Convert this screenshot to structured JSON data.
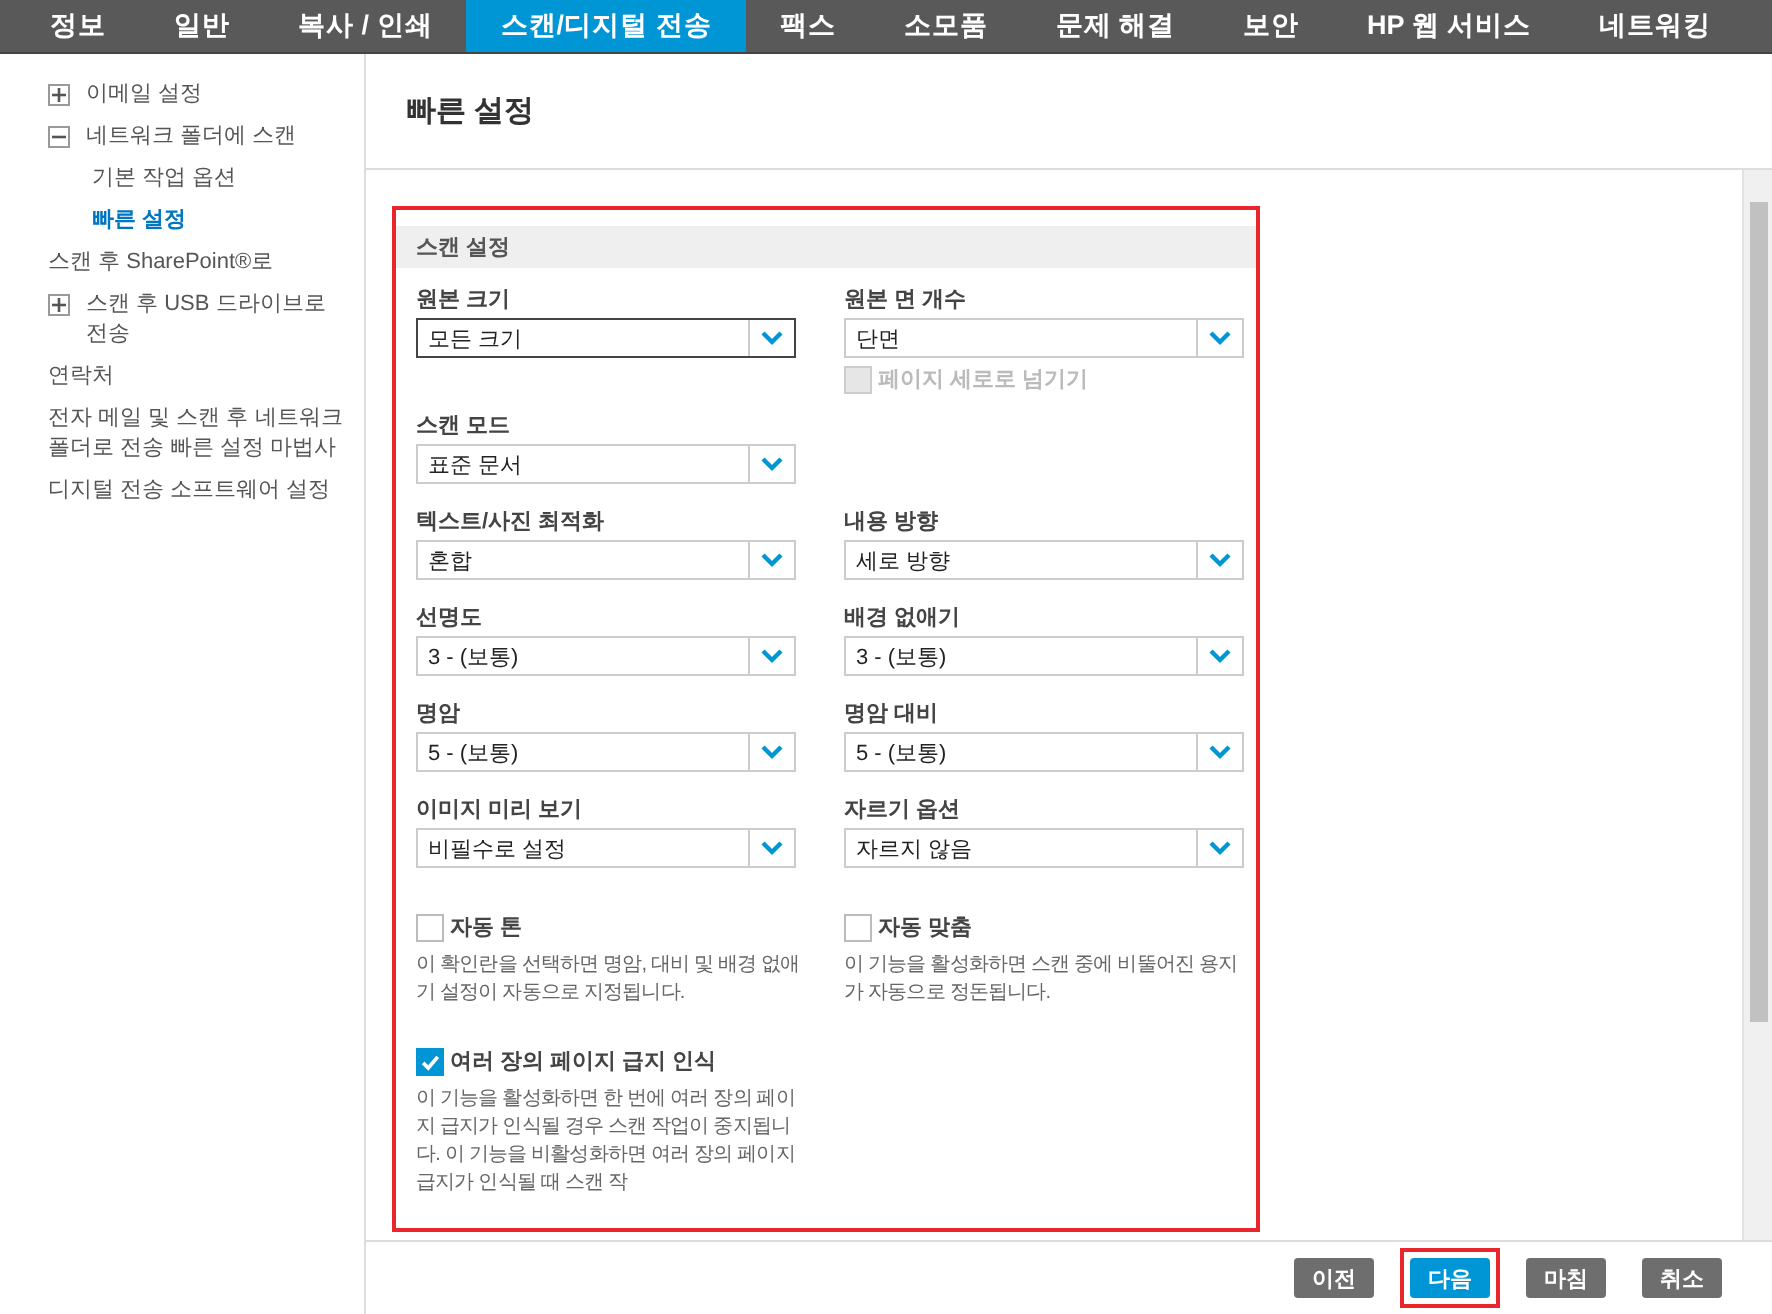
{
  "nav_tabs": [
    {
      "label": "정보",
      "selected": false
    },
    {
      "label": "일반",
      "selected": false
    },
    {
      "label": "복사 / 인쇄",
      "selected": false
    },
    {
      "label": "스캔/디지털 전송",
      "selected": true
    },
    {
      "label": "팩스",
      "selected": false
    },
    {
      "label": "소모품",
      "selected": false
    },
    {
      "label": "문제 해결",
      "selected": false
    },
    {
      "label": "보안",
      "selected": false
    },
    {
      "label": "HP 웹 서비스",
      "selected": false
    },
    {
      "label": "네트워킹",
      "selected": false
    }
  ],
  "sidebar": {
    "items": [
      {
        "kind": "group",
        "label": "이메일 설정",
        "expanded": false,
        "selected": false
      },
      {
        "kind": "group",
        "label": "네트워크 폴더에 스캔",
        "expanded": true,
        "selected": false,
        "children": [
          {
            "label": "기본 작업 옵션",
            "selected": false
          },
          {
            "label": "빠른 설정",
            "selected": true
          }
        ]
      },
      {
        "kind": "link",
        "label": "스캔 후 SharePoint®로",
        "selected": false
      },
      {
        "kind": "group",
        "label": "스캔 후 USB 드라이브로 전송",
        "expanded": false,
        "selected": false
      },
      {
        "kind": "link",
        "label": "연락처",
        "selected": false
      },
      {
        "kind": "link",
        "label": "전자 메일 및 스캔 후 네트워크 폴더로 전송 빠른 설정 마법사",
        "selected": false
      },
      {
        "kind": "link",
        "label": "디지털 전송 소프트웨어 설정",
        "selected": false
      }
    ]
  },
  "page_title": "빠른 설정",
  "section": {
    "title": "스캔 설정",
    "rows": [
      [
        {
          "label": "원본 크기",
          "value": "모든 크기",
          "focused": true
        },
        {
          "label": "원본 면 개수",
          "value": "단면",
          "focused": false,
          "option": {
            "label": "페이지 세로로 넘기기",
            "checked": false,
            "disabled": true
          }
        }
      ],
      [
        {
          "label": "스캔 모드",
          "value": "표준 문서",
          "focused": false
        }
      ],
      [
        {
          "label": "텍스트/사진 최적화",
          "value": "혼합",
          "focused": false
        },
        {
          "label": "내용 방향",
          "value": "세로 방향",
          "focused": false
        }
      ],
      [
        {
          "label": "선명도",
          "value": "3 - (보통)",
          "focused": false
        },
        {
          "label": "배경 없애기",
          "value": "3 - (보통)",
          "focused": false
        }
      ],
      [
        {
          "label": "명암",
          "value": "5 - (보통)",
          "focused": false
        },
        {
          "label": "명암 대비",
          "value": "5 - (보통)",
          "focused": false
        }
      ],
      [
        {
          "label": "이미지 미리 보기",
          "value": "비필수로 설정",
          "focused": false
        },
        {
          "label": "자르기 옵션",
          "value": "자르지 않음",
          "focused": false
        }
      ]
    ],
    "checkbox_rows": [
      [
        {
          "label": "자동 톤",
          "checked": false,
          "description": "이 확인란을 선택하면 명암, 대비 및 배경 없애기 설정이 자동으로 지정됩니다."
        },
        {
          "label": "자동 맞춤",
          "checked": false,
          "description": "이 기능을 활성화하면 스캔 중에 비뚤어진 용지가 자동으로 정돈됩니다."
        }
      ],
      [
        {
          "label": "여러 장의 페이지 급지 인식",
          "checked": true,
          "description": "이 기능을 활성화하면 한 번에 여러 장의 페이지 급지가 인식될 경우 스캔 작업이 중지됩니다. 이 기능을 비활성화하면 여러 장의 페이지 급지가 인식될 때 스캔 작"
        }
      ]
    ]
  },
  "buttons": [
    {
      "label": "이전",
      "primary": false,
      "highlighted": false
    },
    {
      "label": "다음",
      "primary": true,
      "highlighted": true
    },
    {
      "label": "마침",
      "primary": false,
      "highlighted": false
    },
    {
      "label": "취소",
      "primary": false,
      "highlighted": false
    }
  ]
}
